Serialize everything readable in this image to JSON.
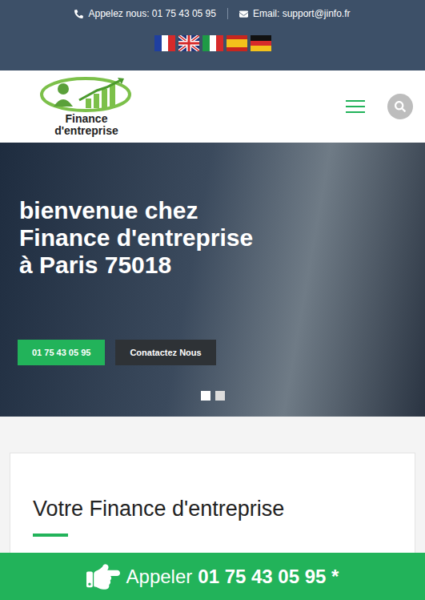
{
  "top_bar": {
    "phone_label": "Appelez nous: 01 75 43 05 95",
    "email_label": "Email: support@jinfo.fr",
    "flags": [
      {
        "kind": "fr"
      },
      {
        "kind": "gb"
      },
      {
        "kind": "it"
      },
      {
        "kind": "es"
      },
      {
        "kind": "de"
      }
    ]
  },
  "logo": {
    "line1": "Finance",
    "line2": "d'entreprise"
  },
  "hero": {
    "title_lines": [
      "bienvenue chez",
      "Finance d'entreprise",
      "à Paris 75018"
    ],
    "buttons": [
      {
        "label": "01 75 43 05 95",
        "kind": "primary"
      },
      {
        "label": "Conatactez Nous",
        "kind": "dark"
      }
    ],
    "slides": [
      {
        "selected": true
      },
      {
        "selected": false
      }
    ]
  },
  "section": {
    "heading": "Votre Finance d'entreprise"
  },
  "call_bar": {
    "prefix": "Appeler",
    "number": "01 75 43 05 95 *"
  }
}
